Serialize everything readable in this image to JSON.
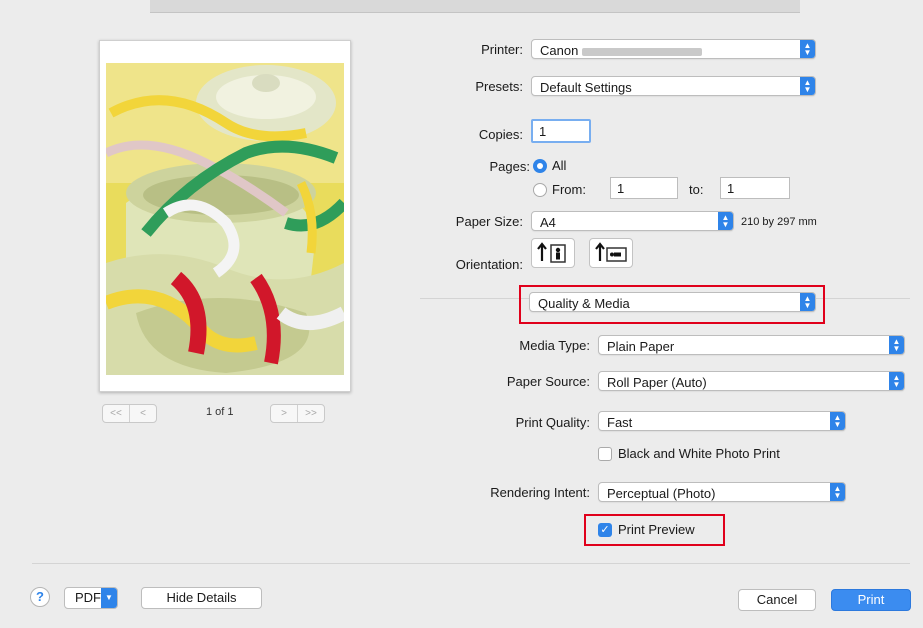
{
  "preview": {
    "page_counter": "1 of 1",
    "nav_first": "<<",
    "nav_prev": "<",
    "nav_next": ">",
    "nav_last": ">>"
  },
  "printer": {
    "label": "Printer:",
    "value": "Canon"
  },
  "presets": {
    "label": "Presets:",
    "value": "Default Settings"
  },
  "copies": {
    "label": "Copies:",
    "value": "1"
  },
  "pages": {
    "label": "Pages:",
    "all_label": "All",
    "from_label": "From:",
    "from_value": "1",
    "to_label": "to:",
    "to_value": "1",
    "selected": "All"
  },
  "paper_size": {
    "label": "Paper Size:",
    "value": "A4",
    "dimensions": "210 by 297 mm"
  },
  "orientation": {
    "label": "Orientation:",
    "selected": "portrait"
  },
  "section_popup": {
    "value": "Quality & Media"
  },
  "media_type": {
    "label": "Media Type:",
    "value": "Plain Paper"
  },
  "paper_source": {
    "label": "Paper Source:",
    "value": "Roll Paper (Auto)"
  },
  "print_quality": {
    "label": "Print Quality:",
    "value": "Fast"
  },
  "bw_photo": {
    "label": "Black and White Photo Print",
    "checked": false
  },
  "rendering_intent": {
    "label": "Rendering Intent:",
    "value": "Perceptual (Photo)"
  },
  "print_preview": {
    "label": "Print Preview",
    "checked": true
  },
  "footer": {
    "help": "?",
    "pdf": "PDF",
    "hide_details": "Hide Details",
    "cancel": "Cancel",
    "print": "Print"
  },
  "colors": {
    "accent": "#2f84e9",
    "highlight": "#e0001b",
    "background": "#ececec"
  }
}
